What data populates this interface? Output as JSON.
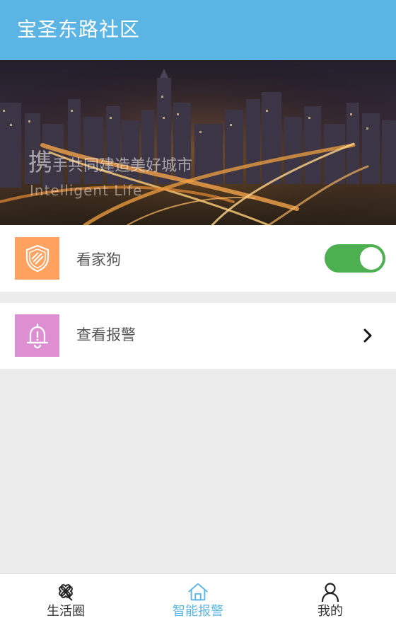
{
  "header": {
    "title": "宝圣东路社区"
  },
  "banner": {
    "slogan_first_char": "携",
    "slogan_rest": "手共同建造美好城市",
    "slogan_en": "Intelligent Life"
  },
  "rows": {
    "guard": {
      "label": "看家狗",
      "icon": "shield-icon",
      "icon_bg": "#ffa15f",
      "toggle_on": true,
      "toggle_color": "#4caf50"
    },
    "alarm": {
      "label": "查看报警",
      "icon": "bell-icon",
      "icon_bg": "#de8fd1"
    }
  },
  "bottom_nav": {
    "items": [
      {
        "label": "生活圈",
        "icon": "clover-icon",
        "active": false
      },
      {
        "label": "智能报警",
        "icon": "home-icon",
        "active": true
      },
      {
        "label": "我的",
        "icon": "user-icon",
        "active": false
      }
    ]
  },
  "colors": {
    "accent": "#5bb5e4",
    "background": "#ececec"
  }
}
